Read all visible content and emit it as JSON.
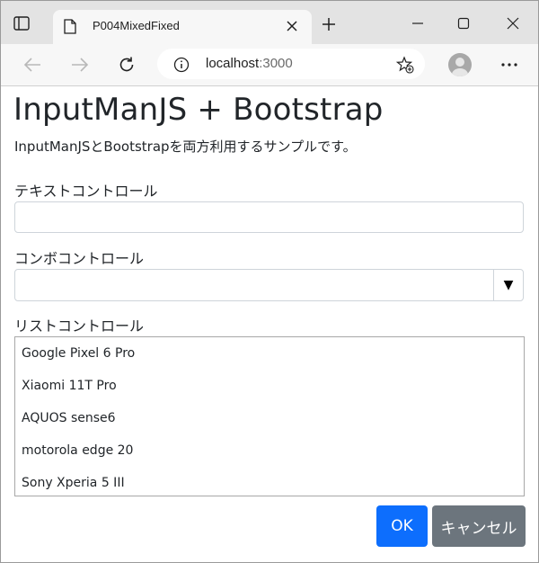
{
  "browser": {
    "tab_title": "P004MixedFixed",
    "url_host": "localhost",
    "url_port": ":3000"
  },
  "page": {
    "heading": "InputManJS + Bootstrap",
    "lead": "InputManJSとBootstrapを両方利用するサンプルです。",
    "text_label": "テキストコントロール",
    "text_value": "",
    "combo_label": "コンボコントロール",
    "combo_value": "",
    "combo_dropdown_glyph": "▼",
    "list_label": "リストコントロール",
    "list_items": [
      {
        "label": "Google Pixel 6 Pro"
      },
      {
        "label": "Xiaomi 11T Pro"
      },
      {
        "label": "AQUOS sense6"
      },
      {
        "label": "motorola edge 20"
      },
      {
        "label": "Sony Xperia 5 III"
      }
    ],
    "ok_label": "OK",
    "cancel_label": "キャンセル"
  },
  "colors": {
    "primary": "#0d6efd",
    "secondary": "#6c757d",
    "titlebar": "#e3e3e3",
    "toolbar": "#f7f7f7"
  },
  "icons": [
    "tab-actions-icon",
    "page-icon",
    "close-icon",
    "plus-icon",
    "minimize-icon",
    "maximize-icon",
    "window-close-icon",
    "back-arrow-icon",
    "forward-arrow-icon",
    "refresh-icon",
    "info-icon",
    "add-favorite-icon",
    "profile-icon",
    "more-icon"
  ]
}
